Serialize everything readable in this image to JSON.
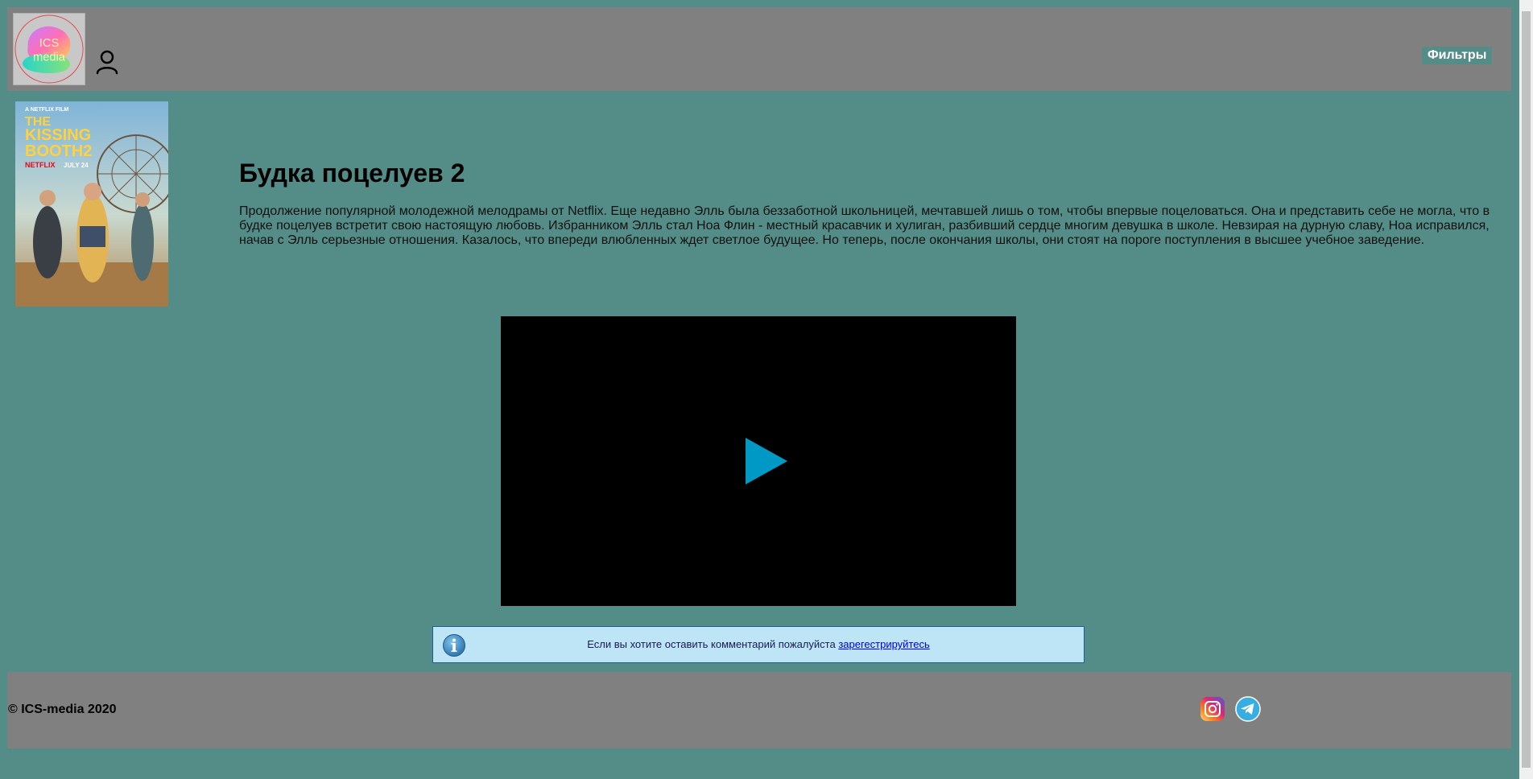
{
  "header": {
    "logo_text_line1": "ICS",
    "logo_text_line2": "media",
    "filters_label": "Фильтры"
  },
  "movie": {
    "poster_top_text": "A NETFLIX FILM",
    "poster_title_line1": "THE",
    "poster_title_line2": "KISSING",
    "poster_title_line3": "BOOTH2",
    "poster_brand": "NETFLIX",
    "poster_date": "JULY 24",
    "title": "Будка поцелуев 2",
    "description": "Продолжение популярной молодежной мелодрамы от Netflix. Еще недавно Элль была беззаботной школьницей, мечтавшей лишь о том, чтобы впервые поцеловаться. Она и представить себе не могла, что в будке поцелуев встретит свою настоящую любовь. Избранником Элль стал Ноа Флин - местный красавчик и хулиган, разбивший сердце многим девушка в школе. Невзирая на дурную славу, Ноа исправился, начав с Элль серьезные отношения. Казалось, что впереди влюбленных ждет светлое будущее. Но теперь, после окончания школы, они стоят на пороге поступления в высшее учебное заведение."
  },
  "notice": {
    "text": "Если вы хотите оставить комментарий пожалуйста ",
    "link": "зарегестрируйтесь"
  },
  "footer": {
    "copyright": "© ICS-media 2020"
  },
  "colors": {
    "page_bg": "#548c88",
    "bar_bg": "#808080",
    "play_button": "#0099c6",
    "notice_bg": "#bde5f6"
  },
  "icons": {
    "user": "user-icon",
    "play": "play-icon",
    "info": "info-icon",
    "instagram": "instagram-icon",
    "telegram": "telegram-icon"
  }
}
